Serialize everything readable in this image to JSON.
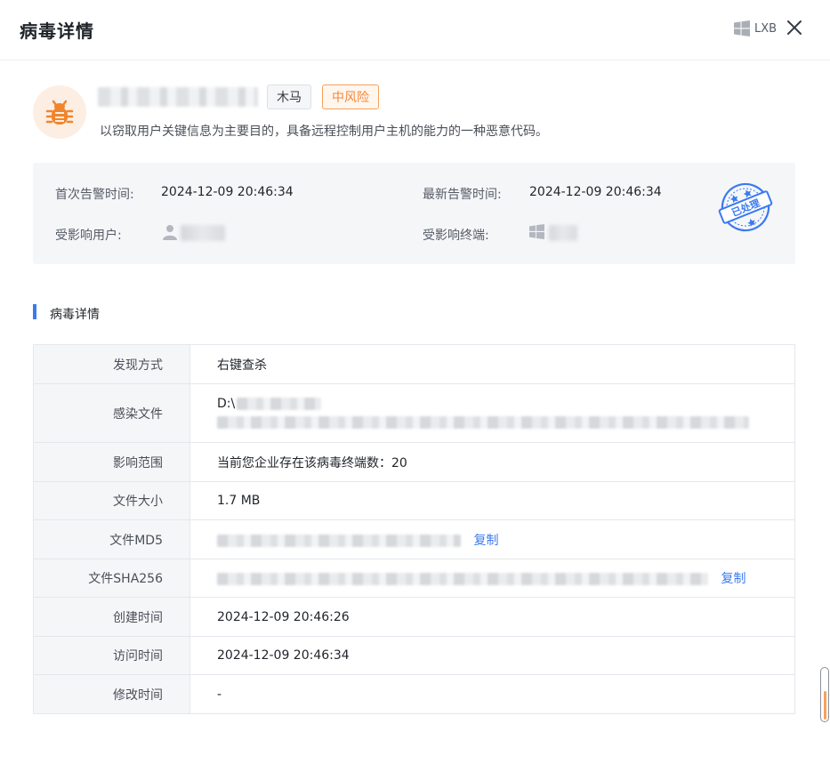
{
  "header": {
    "title": "病毒详情",
    "host_label": "LXB",
    "os_icon": "windows-icon",
    "close_icon": "close-icon"
  },
  "virus": {
    "icon": "bug-icon",
    "type_tag": "木马",
    "risk_tag": "中风险",
    "description": "以窃取用户关键信息为主要目的，具备远程控制用户主机的能力的一种恶意代码。"
  },
  "info": {
    "first_alert_label": "首次告警时间:",
    "first_alert_value": "2024-12-09 20:46:34",
    "latest_alert_label": "最新告警时间:",
    "latest_alert_value": "2024-12-09 20:46:34",
    "affected_user_label": "受影响用户:",
    "affected_terminal_label": "受影响终端:",
    "stamp_text": "已处理"
  },
  "section": {
    "title": "病毒详情"
  },
  "details": {
    "discovery_label": "发现方式",
    "discovery_value": "右键查杀",
    "infected_file_label": "感染文件",
    "infected_file_prefix": "D:\\",
    "scope_label": "影响范围",
    "scope_value": "当前您企业存在该病毒终端数：20",
    "size_label": "文件大小",
    "size_value": "1.7 MB",
    "md5_label": "文件MD5",
    "md5_copy": "复制",
    "sha256_label": "文件SHA256",
    "sha256_copy": "复制",
    "created_label": "创建时间",
    "created_value": "2024-12-09 20:46:26",
    "accessed_label": "访问时间",
    "accessed_value": "2024-12-09 20:46:34",
    "modified_label": "修改时间",
    "modified_value": "-"
  },
  "colors": {
    "accent": "#3a7af0",
    "risk_orange": "#f08a3a",
    "bug_orange": "#f0852d"
  }
}
